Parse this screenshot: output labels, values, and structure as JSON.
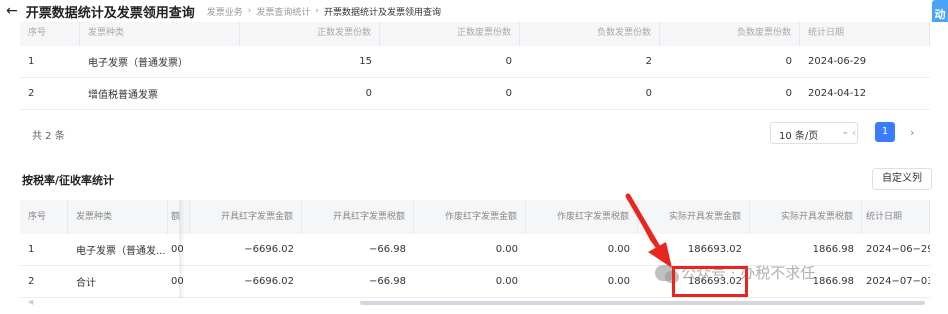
{
  "header": {
    "back_glyph": "←",
    "title": "开票数据统计及发票领用查询",
    "breadcrumb": [
      "发票业务",
      "发票查询统计",
      "开票数据统计及发票领用查询"
    ],
    "breadcrumb_sep": "›",
    "corner_text": "动"
  },
  "table1": {
    "columns": [
      "序号",
      "发票种类",
      "正数发票份数",
      "正数废票份数",
      "负数发票份数",
      "负数废票份数",
      "统计日期"
    ],
    "rows": [
      [
        "1",
        "电子发票（普通发票）",
        "15",
        "0",
        "2",
        "0",
        "2024-06-29"
      ],
      [
        "2",
        "增值税普通发票",
        "0",
        "0",
        "0",
        "0",
        "2024-04-12"
      ]
    ]
  },
  "pagination": {
    "total": "共 2 条",
    "page_size": "10 条/页",
    "size_arrow": "⌄",
    "prev": "‹",
    "current": "1",
    "next": "›"
  },
  "section2": {
    "title": "按税率/征收率统计",
    "custom_columns_button": "自定义列"
  },
  "table2": {
    "columns": [
      "序号",
      "发票种类",
      "额",
      "开具红字发票金额",
      "开具红字发票税额",
      "作废红字发票金额",
      "作废红字发票税额",
      "实际开具发票金额",
      "实际开具发票税额",
      "统计日期"
    ],
    "rows": [
      [
        "1",
        "电子发票（普通发...",
        "00",
        "−6696.02",
        "−66.98",
        "0.00",
        "0.00",
        "186693.02",
        "1866.98",
        "2024−06−29"
      ],
      [
        "2",
        "合计",
        "00",
        "−6696.02",
        "−66.98",
        "0.00",
        "0.00",
        "186693.02",
        "1866.98",
        "2024−07−03"
      ]
    ]
  },
  "watermark": "公众号 · 办税不求任",
  "colors": {
    "accent": "#3b7cff",
    "annotation_red": "#e8261f",
    "header_bg": "#f5f6f8"
  }
}
